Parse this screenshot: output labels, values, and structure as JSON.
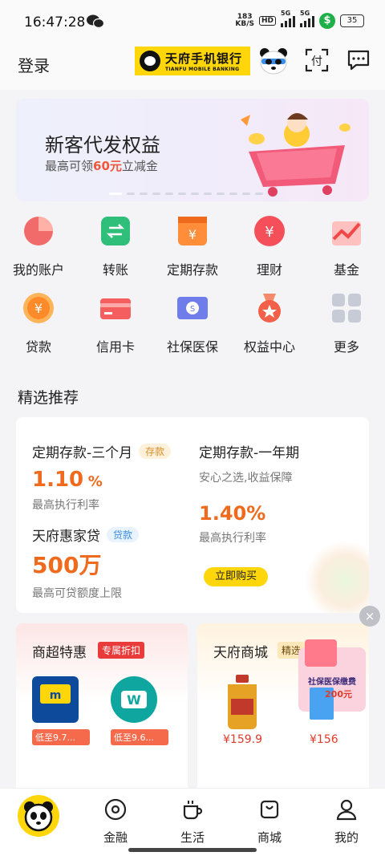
{
  "status": {
    "time": "16:47:28",
    "net_speed_top": "183",
    "net_speed_bottom": "KB/S",
    "hd": "HD",
    "sig1_label": "5G",
    "sig2_label": "5G",
    "battery": "35"
  },
  "header": {
    "login": "登录",
    "logo_cn": "天府手机银行",
    "logo_en": "TIANFU MOBILE BANKING"
  },
  "banner": {
    "title": "新客代发权益",
    "sub_prefix": "最高可领",
    "sub_amount": "60元",
    "sub_suffix": "立减金"
  },
  "grid": {
    "items": [
      {
        "label": "我的账户"
      },
      {
        "label": "转账"
      },
      {
        "label": "定期存款"
      },
      {
        "label": "理财"
      },
      {
        "label": "基金"
      },
      {
        "label": "贷款"
      },
      {
        "label": "信用卡"
      },
      {
        "label": "社保医保"
      },
      {
        "label": "权益中心"
      },
      {
        "label": "更多"
      }
    ]
  },
  "section": {
    "title": "精选推荐"
  },
  "products": {
    "p1": {
      "title": "定期存款-三个月",
      "tag": "存款",
      "rate": "1.10",
      "unit": "%",
      "sub": "最高执行利率"
    },
    "p2": {
      "title": "定期存款-一年期",
      "desc": "安心之选,收益保障",
      "rate": "1.40%",
      "sub": "最高执行利率"
    },
    "p3": {
      "title": "天府惠家贷",
      "tag": "贷款",
      "amount": "500万",
      "sub": "最高可贷额度上限"
    },
    "buy": "立即购买"
  },
  "left_card": {
    "title": "商超特惠",
    "tag": "专属折扣",
    "stores": [
      {
        "name": "麦德龙",
        "discount": "低至9.7..."
      },
      {
        "name": "W",
        "discount": "低至9.6..."
      }
    ]
  },
  "right_card": {
    "title": "天府商城",
    "tag": "精选",
    "promo": "社保医保缴费 最高立减200元",
    "prices": [
      "¥159.9",
      "¥156"
    ]
  },
  "close": "×",
  "tabbar": {
    "tabs": [
      {
        "label": "金融"
      },
      {
        "label": "生活"
      },
      {
        "label": "商城"
      },
      {
        "label": "我的"
      }
    ]
  },
  "colors": {
    "brand_yellow": "#ffd60a",
    "accent_orange": "#f06a1d",
    "tag_red": "#ea3b3b"
  }
}
